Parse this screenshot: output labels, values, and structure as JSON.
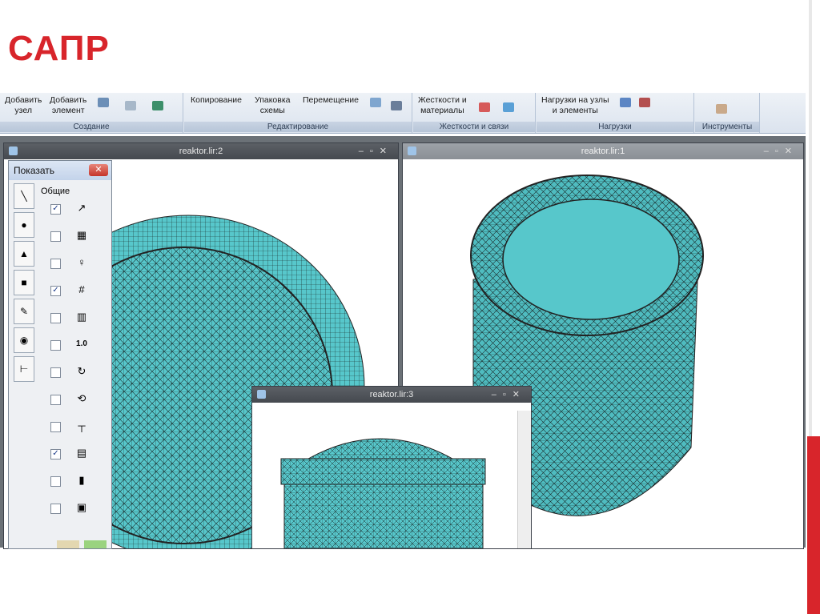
{
  "slide": {
    "title": "САПР"
  },
  "ribbon": {
    "groups": [
      {
        "label": "Создание",
        "buttons": [
          "Добавить\nузел",
          "Добавить\nэлемент"
        ]
      },
      {
        "label": "Редактирование",
        "buttons": [
          "Копирование",
          "Упаковка\nсхемы",
          "Перемещение"
        ]
      },
      {
        "label": "Жесткости и связи",
        "buttons": [
          "Жесткости и\nматериалы"
        ]
      },
      {
        "label": "Нагрузки",
        "buttons": [
          "Нагрузки на узлы\nи элементы"
        ]
      },
      {
        "label": "Инструменты",
        "buttons": []
      }
    ]
  },
  "windows": {
    "w2": {
      "title": "reaktor.lir:2"
    },
    "w1": {
      "title": "reaktor.lir:1"
    },
    "w3": {
      "title": "reaktor.lir:3"
    }
  },
  "panel": {
    "title": "Показать",
    "close": "✕",
    "section": "Общие",
    "rows": [
      {
        "checked": true,
        "icon": "axes-icon"
      },
      {
        "checked": false,
        "icon": "box-icon"
      },
      {
        "checked": false,
        "icon": "node-icon"
      },
      {
        "checked": true,
        "icon": "grid-icon"
      },
      {
        "checked": false,
        "icon": "frame-grid-icon"
      },
      {
        "checked": false,
        "icon": "value-icon",
        "text": "1.0"
      },
      {
        "checked": false,
        "icon": "rotate-icon"
      },
      {
        "checked": false,
        "icon": "rotate-axis-icon"
      },
      {
        "checked": false,
        "icon": "support-icon"
      },
      {
        "checked": true,
        "icon": "plate-icon"
      },
      {
        "checked": false,
        "icon": "color-scale-icon"
      },
      {
        "checked": false,
        "icon": "red-frame-icon"
      }
    ]
  },
  "colors": {
    "accent": "#d8252b",
    "mesh": "#57c7cb"
  }
}
